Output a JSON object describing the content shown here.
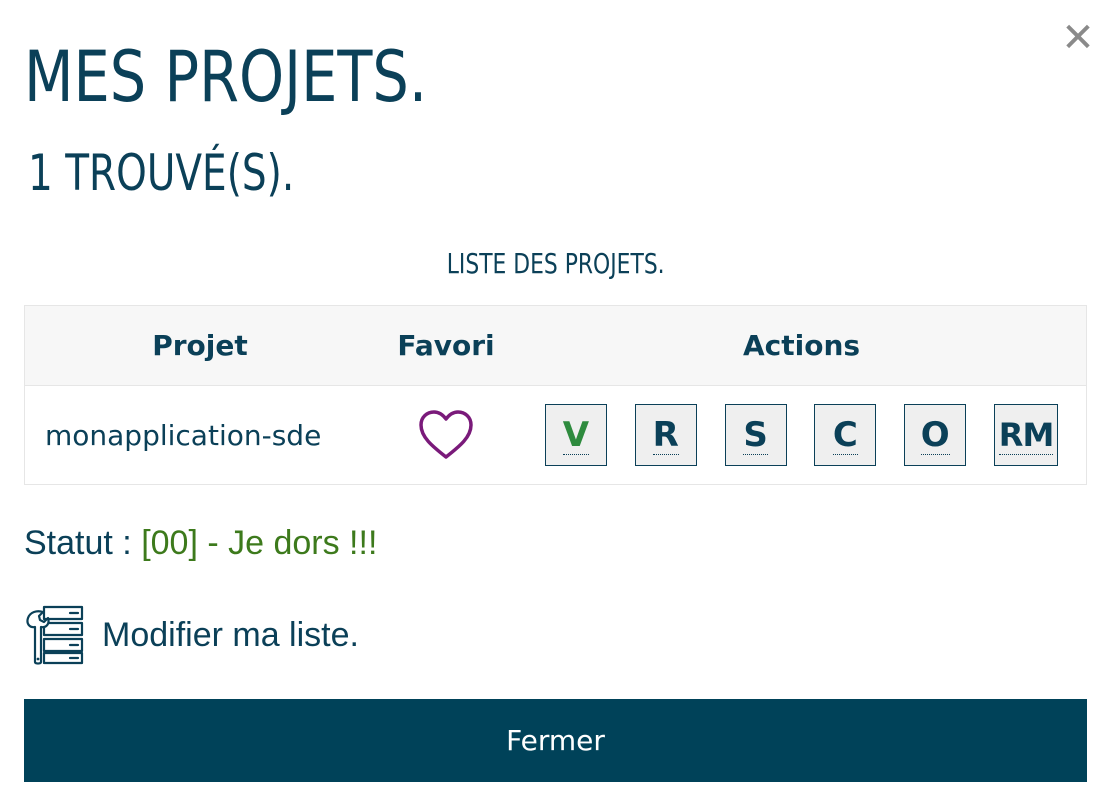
{
  "header": {
    "title": "MES PROJETS.",
    "subtitle": "1 TROUVÉ(S).",
    "close_symbol": "✕",
    "close_icon": "close-icon"
  },
  "list": {
    "caption": "LISTE DES PROJETS.",
    "columns": [
      "Projet",
      "Favori",
      "Actions"
    ],
    "rows": [
      {
        "project": "monapplication-sde",
        "favorite_icon": "heart-outline-icon",
        "actions": [
          "V",
          "R",
          "S",
          "C",
          "O",
          "RM"
        ]
      }
    ]
  },
  "status": {
    "label": "Statut : ",
    "value": "[00] - Je dors !!!"
  },
  "modify": {
    "label": "Modifier ma liste.",
    "icon": "server-wrench-icon"
  },
  "footer": {
    "close_label": "Fermer"
  },
  "colors": {
    "primary": "#004259",
    "text": "#0b4058",
    "status_value": "#3d7a1c",
    "favorite": "#7a1a7a",
    "action_green": "#2e8b3e",
    "close_icon": "#8a8a8a"
  }
}
